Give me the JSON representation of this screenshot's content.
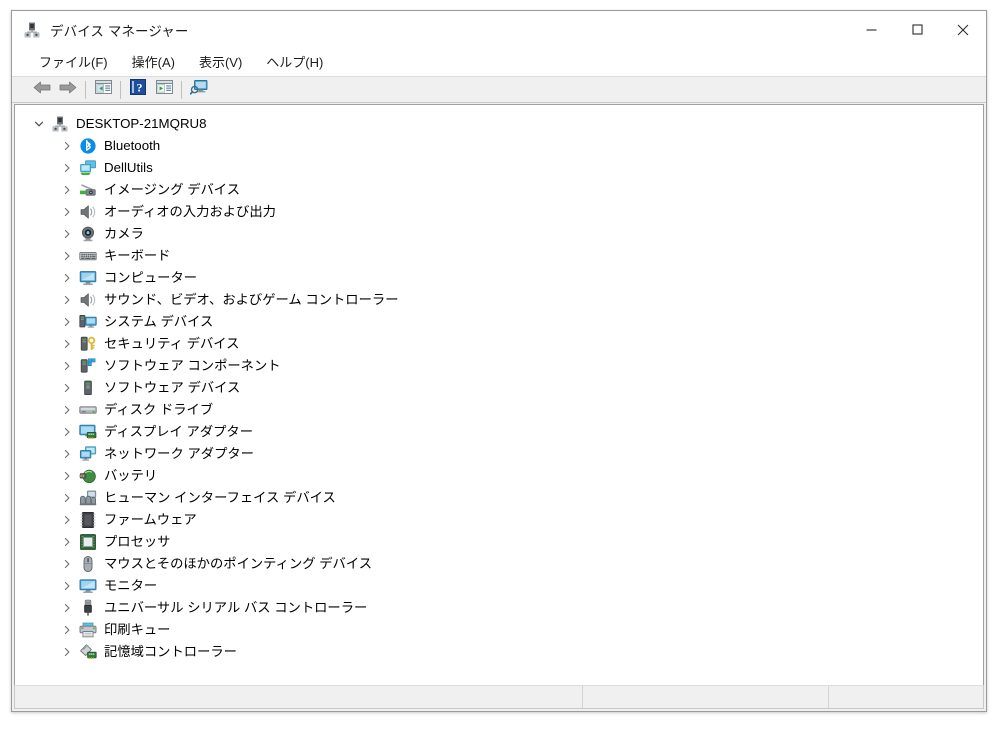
{
  "window": {
    "title": "デバイス マネージャー",
    "title_icon": "device-manager-icon",
    "controls": {
      "minimize": "最小化",
      "maximize": "最大化",
      "close": "閉じる"
    }
  },
  "menubar": {
    "items": [
      {
        "label": "ファイル(F)",
        "name": "menu-file"
      },
      {
        "label": "操作(A)",
        "name": "menu-action"
      },
      {
        "label": "表示(V)",
        "name": "menu-view"
      },
      {
        "label": "ヘルプ(H)",
        "name": "menu-help"
      }
    ]
  },
  "toolbar": {
    "buttons": [
      {
        "name": "back-button",
        "icon": "arrow-left-icon",
        "tooltip": "戻る"
      },
      {
        "name": "forward-button",
        "icon": "arrow-right-icon",
        "tooltip": "進む"
      },
      {
        "name": "show-hide-console-tree-button",
        "icon": "console-tree-icon",
        "tooltip": "コンソール ツリーの表示/非表示"
      },
      {
        "name": "help-button",
        "icon": "help-question-icon",
        "tooltip": "ヘルプ"
      },
      {
        "name": "properties-button",
        "icon": "properties-icon",
        "tooltip": "プロパティ"
      },
      {
        "name": "scan-hardware-changes-button",
        "icon": "scan-hardware-icon",
        "tooltip": "ハードウェア変更のスキャン"
      }
    ]
  },
  "tree": {
    "root": {
      "label": "DESKTOP-21MQRU8",
      "icon": "computer-root-icon",
      "expanded": true,
      "chevron": "chevron-down-icon"
    },
    "nodes": [
      {
        "label": "Bluetooth",
        "icon": "bluetooth-icon",
        "chevron": "chevron-right-icon"
      },
      {
        "label": "DellUtils",
        "icon": "dell-utils-icon",
        "chevron": "chevron-right-icon"
      },
      {
        "label": "イメージング デバイス",
        "icon": "imaging-device-icon",
        "chevron": "chevron-right-icon"
      },
      {
        "label": "オーディオの入力および出力",
        "icon": "audio-speaker-icon",
        "chevron": "chevron-right-icon"
      },
      {
        "label": "カメラ",
        "icon": "camera-icon",
        "chevron": "chevron-right-icon"
      },
      {
        "label": "キーボード",
        "icon": "keyboard-icon",
        "chevron": "chevron-right-icon"
      },
      {
        "label": "コンピューター",
        "icon": "computer-icon",
        "chevron": "chevron-right-icon"
      },
      {
        "label": "サウンド、ビデオ、およびゲーム コントローラー",
        "icon": "audio-speaker-icon",
        "chevron": "chevron-right-icon"
      },
      {
        "label": "システム デバイス",
        "icon": "system-device-icon",
        "chevron": "chevron-right-icon"
      },
      {
        "label": "セキュリティ デバイス",
        "icon": "security-device-icon",
        "chevron": "chevron-right-icon"
      },
      {
        "label": "ソフトウェア コンポーネント",
        "icon": "software-component-icon",
        "chevron": "chevron-right-icon"
      },
      {
        "label": "ソフトウェア デバイス",
        "icon": "software-device-icon",
        "chevron": "chevron-right-icon"
      },
      {
        "label": "ディスク ドライブ",
        "icon": "disk-drive-icon",
        "chevron": "chevron-right-icon"
      },
      {
        "label": "ディスプレイ アダプター",
        "icon": "display-adapter-icon",
        "chevron": "chevron-right-icon"
      },
      {
        "label": "ネットワーク アダプター",
        "icon": "network-adapter-icon",
        "chevron": "chevron-right-icon"
      },
      {
        "label": "バッテリ",
        "icon": "battery-icon",
        "chevron": "chevron-right-icon"
      },
      {
        "label": "ヒューマン インターフェイス デバイス",
        "icon": "hid-icon",
        "chevron": "chevron-right-icon"
      },
      {
        "label": "ファームウェア",
        "icon": "firmware-icon",
        "chevron": "chevron-right-icon"
      },
      {
        "label": "プロセッサ",
        "icon": "processor-icon",
        "chevron": "chevron-right-icon"
      },
      {
        "label": "マウスとそのほかのポインティング デバイス",
        "icon": "mouse-icon",
        "chevron": "chevron-right-icon"
      },
      {
        "label": "モニター",
        "icon": "monitor-icon",
        "chevron": "chevron-right-icon"
      },
      {
        "label": "ユニバーサル シリアル バス コントローラー",
        "icon": "usb-icon",
        "chevron": "chevron-right-icon"
      },
      {
        "label": "印刷キュー",
        "icon": "print-queue-icon",
        "chevron": "chevron-right-icon"
      },
      {
        "label": "記憶域コントローラー",
        "icon": "storage-controller-icon",
        "chevron": "chevron-right-icon"
      }
    ]
  },
  "statusbar": {
    "cells": [
      "",
      "",
      ""
    ]
  },
  "colors": {
    "window_bg": "#f0f0f0",
    "pane_bg": "#ffffff",
    "text": "#000000",
    "bluetooth_blue": "#0b8ce8",
    "accent_green": "#3faf46",
    "monitor_blue": "#3a9fd8",
    "border": "#a0a0a0"
  }
}
